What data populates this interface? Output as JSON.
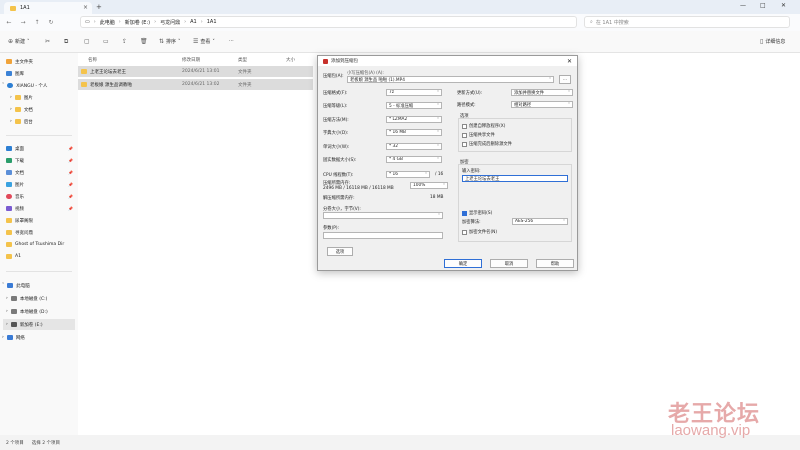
{
  "tab": {
    "title": "1A1"
  },
  "nav": {
    "breadcrumbs": [
      "此电脑",
      "新加卷 (E:)",
      "弓龙问鼎",
      "A1",
      "1A1"
    ],
    "search_placeholder": "在 1A1 中搜索"
  },
  "toolbar": {
    "new": "新建",
    "sort": "排序",
    "view": "查看",
    "more": "···",
    "details": "详细信息"
  },
  "sidebar": {
    "home": "主文件夹",
    "gallery": "图库",
    "cloud": "XIANGU - 个人",
    "cloud_items": [
      "图片",
      "文档",
      "后台"
    ],
    "quick": [
      "桌面",
      "下载",
      "文档",
      "图片",
      "音乐",
      "视频",
      "尿罩阁限",
      "寻宽问鼎",
      "Ghost of Tsushima  Dir",
      "A1"
    ],
    "this_pc": "此电脑",
    "drives": [
      "本地磁盘 (C:)",
      "本地磁盘 (D:)",
      "新加卷 (E:)"
    ],
    "network": "网络"
  },
  "columns": {
    "name": "名称",
    "date": "修改日期",
    "type": "类型",
    "size": "大小"
  },
  "files": [
    {
      "name": "上老王论坛去老王",
      "date": "2024/6/21 13:01",
      "type": "文件夹"
    },
    {
      "name": "老板娘  源生品调教啪",
      "date": "2024/6/21 13:02",
      "type": "文件夹"
    }
  ],
  "status": {
    "count": "2 个项目",
    "selected": "选择 2 个项目"
  },
  "dialog": {
    "title": "添加到压缩包",
    "archive_name_label": "压缩包(A):",
    "archive_name_hint": "小写压缩包(A) (A):",
    "archive_name_value": "老板娘 源生品 啪啪 (1).MP4",
    "format_label": "压缩格式(F):",
    "format_value": "7z",
    "level_label": "压缩等级(L):",
    "level_value": "5 - 标准压缩",
    "method_label": "压缩方法(M):",
    "method_value": "* LZMA2",
    "dict_label": "字典大小(D):",
    "dict_value": "* 16 MB",
    "word_label": "单词大小(W):",
    "word_value": "* 32",
    "solid_label": "固实数据大小(S):",
    "solid_value": "* 4 GB",
    "cpu_label": "CPU 线程数(T):",
    "cpu_value": "* 16",
    "cpu_total": "/ 16",
    "mem_label": "压缩所需内存:",
    "mem_detail": "2496 MB / 16118 MB / 16118 MB",
    "mem_percent": "100%",
    "decomp_mem_label": "解压缩所需内存:",
    "decomp_mem_value": "18 MB",
    "split_label": "分卷大小，字节(V):",
    "params_label": "参数(P):",
    "options_btn": "选项",
    "update_label": "更新方式(U):",
    "update_value": "添加并替换文件",
    "path_label": "路径模式:",
    "path_value": "相对路径",
    "options_group": "选项",
    "opt1": "创建自释放程序(X)",
    "opt2": "压缩共享文件",
    "opt3": "压缩完成后删除源文件",
    "enc_group": "加密",
    "password_label": "输入密码:",
    "password_value": "上老王论坛去老王",
    "show_password": "显示密码(S)",
    "enc_method_label": "加密算法:",
    "enc_method_value": "AES-256",
    "encrypt_names": "加密文件名(N)",
    "ok": "确定",
    "cancel": "取消",
    "help": "帮助",
    "browse": "..."
  },
  "watermark": {
    "line1": "老王论坛",
    "line2": "laowang.vip"
  }
}
